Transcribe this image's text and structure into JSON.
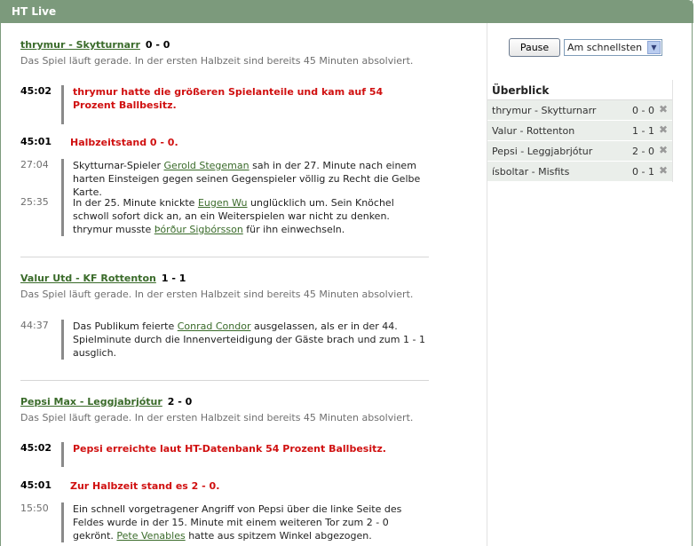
{
  "window": {
    "title": "HT Live"
  },
  "controls": {
    "pause_label": "Pause",
    "speed_value": "Am schnellsten"
  },
  "overview": {
    "heading": "Überblick",
    "rows": [
      {
        "name": "thrymur - Skytturnarr",
        "score": "0 - 0"
      },
      {
        "name": "Valur - Rottenton",
        "score": "1 - 1"
      },
      {
        "name": "Pepsi - Leggjabrjótur",
        "score": "2 - 0"
      },
      {
        "name": "ísboltar - Misfits",
        "score": "0 - 1"
      }
    ]
  },
  "matches": [
    {
      "teams": "thrymur - Skytturnarr",
      "score": "0 - 0",
      "weather": "partly-cloudy",
      "status": "Das Spiel läuft gerade. In der ersten Halbzeit sind bereits 45 Minuten absolviert.",
      "events": [
        {
          "time": "45:02",
          "text": "thrymur hatte die größeren Spielanteile und kam auf 54 Prozent Ballbesitz."
        },
        {
          "time": "45:01",
          "text": "Halbzeitstand 0 - 0."
        },
        {
          "time": "27:04",
          "pre": "Skytturnar-Spieler ",
          "link": "Gerold Stegeman",
          "post": " sah in der 27. Minute nach einem harten Einsteigen gegen seinen Gegenspieler völlig zu Recht die Gelbe Karte."
        },
        {
          "time": "25:35",
          "pre": "In der 25. Minute knickte ",
          "link": "Eugen Wu",
          "mid": " unglücklich um. Sein Knöchel schwoll sofort dick an, an ein Weiterspielen war nicht zu denken. thrymur musste ",
          "link2": "Þórður Sigbórsson",
          "post": " für ihn einwechseln."
        }
      ]
    },
    {
      "teams": "Valur Utd - KF Rottenton",
      "score": "1 - 1",
      "weather": "sunny",
      "status": "Das Spiel läuft gerade. In der ersten Halbzeit sind bereits 45 Minuten absolviert.",
      "events": [
        {
          "time": "44:37",
          "pre": "Das Publikum feierte ",
          "link": "Conrad Condor",
          "post": " ausgelassen, als er in der 44. Spielminute durch die Innenverteidigung der Gäste brach und zum 1 - 1 ausglich."
        }
      ]
    },
    {
      "teams": "Pepsi Max - Leggjabrjótur",
      "score": "2 - 0",
      "weather": "sunny",
      "status": "Das Spiel läuft gerade. In der ersten Halbzeit sind bereits 45 Minuten absolviert.",
      "events": [
        {
          "time": "45:02",
          "text": "Pepsi erreichte laut HT-Datenbank 54 Prozent Ballbesitz."
        },
        {
          "time": "45:01",
          "text": "Zur Halbzeit stand es 2 - 0."
        },
        {
          "time": "15:50",
          "pre": "Ein schnell vorgetragener Angriff von Pepsi über die linke Seite des Feldes wurde in der 15. Minute mit einem weiteren Tor zum 2 - 0 gekrönt. ",
          "link": "Pete Venables",
          "post": " hatte aus spitzem Winkel abgezogen."
        }
      ]
    }
  ],
  "colors": {
    "header": "#7c9a7c",
    "link": "#3a6b2a",
    "highlight": "#d01010",
    "overview_row": "#eaeeea"
  }
}
